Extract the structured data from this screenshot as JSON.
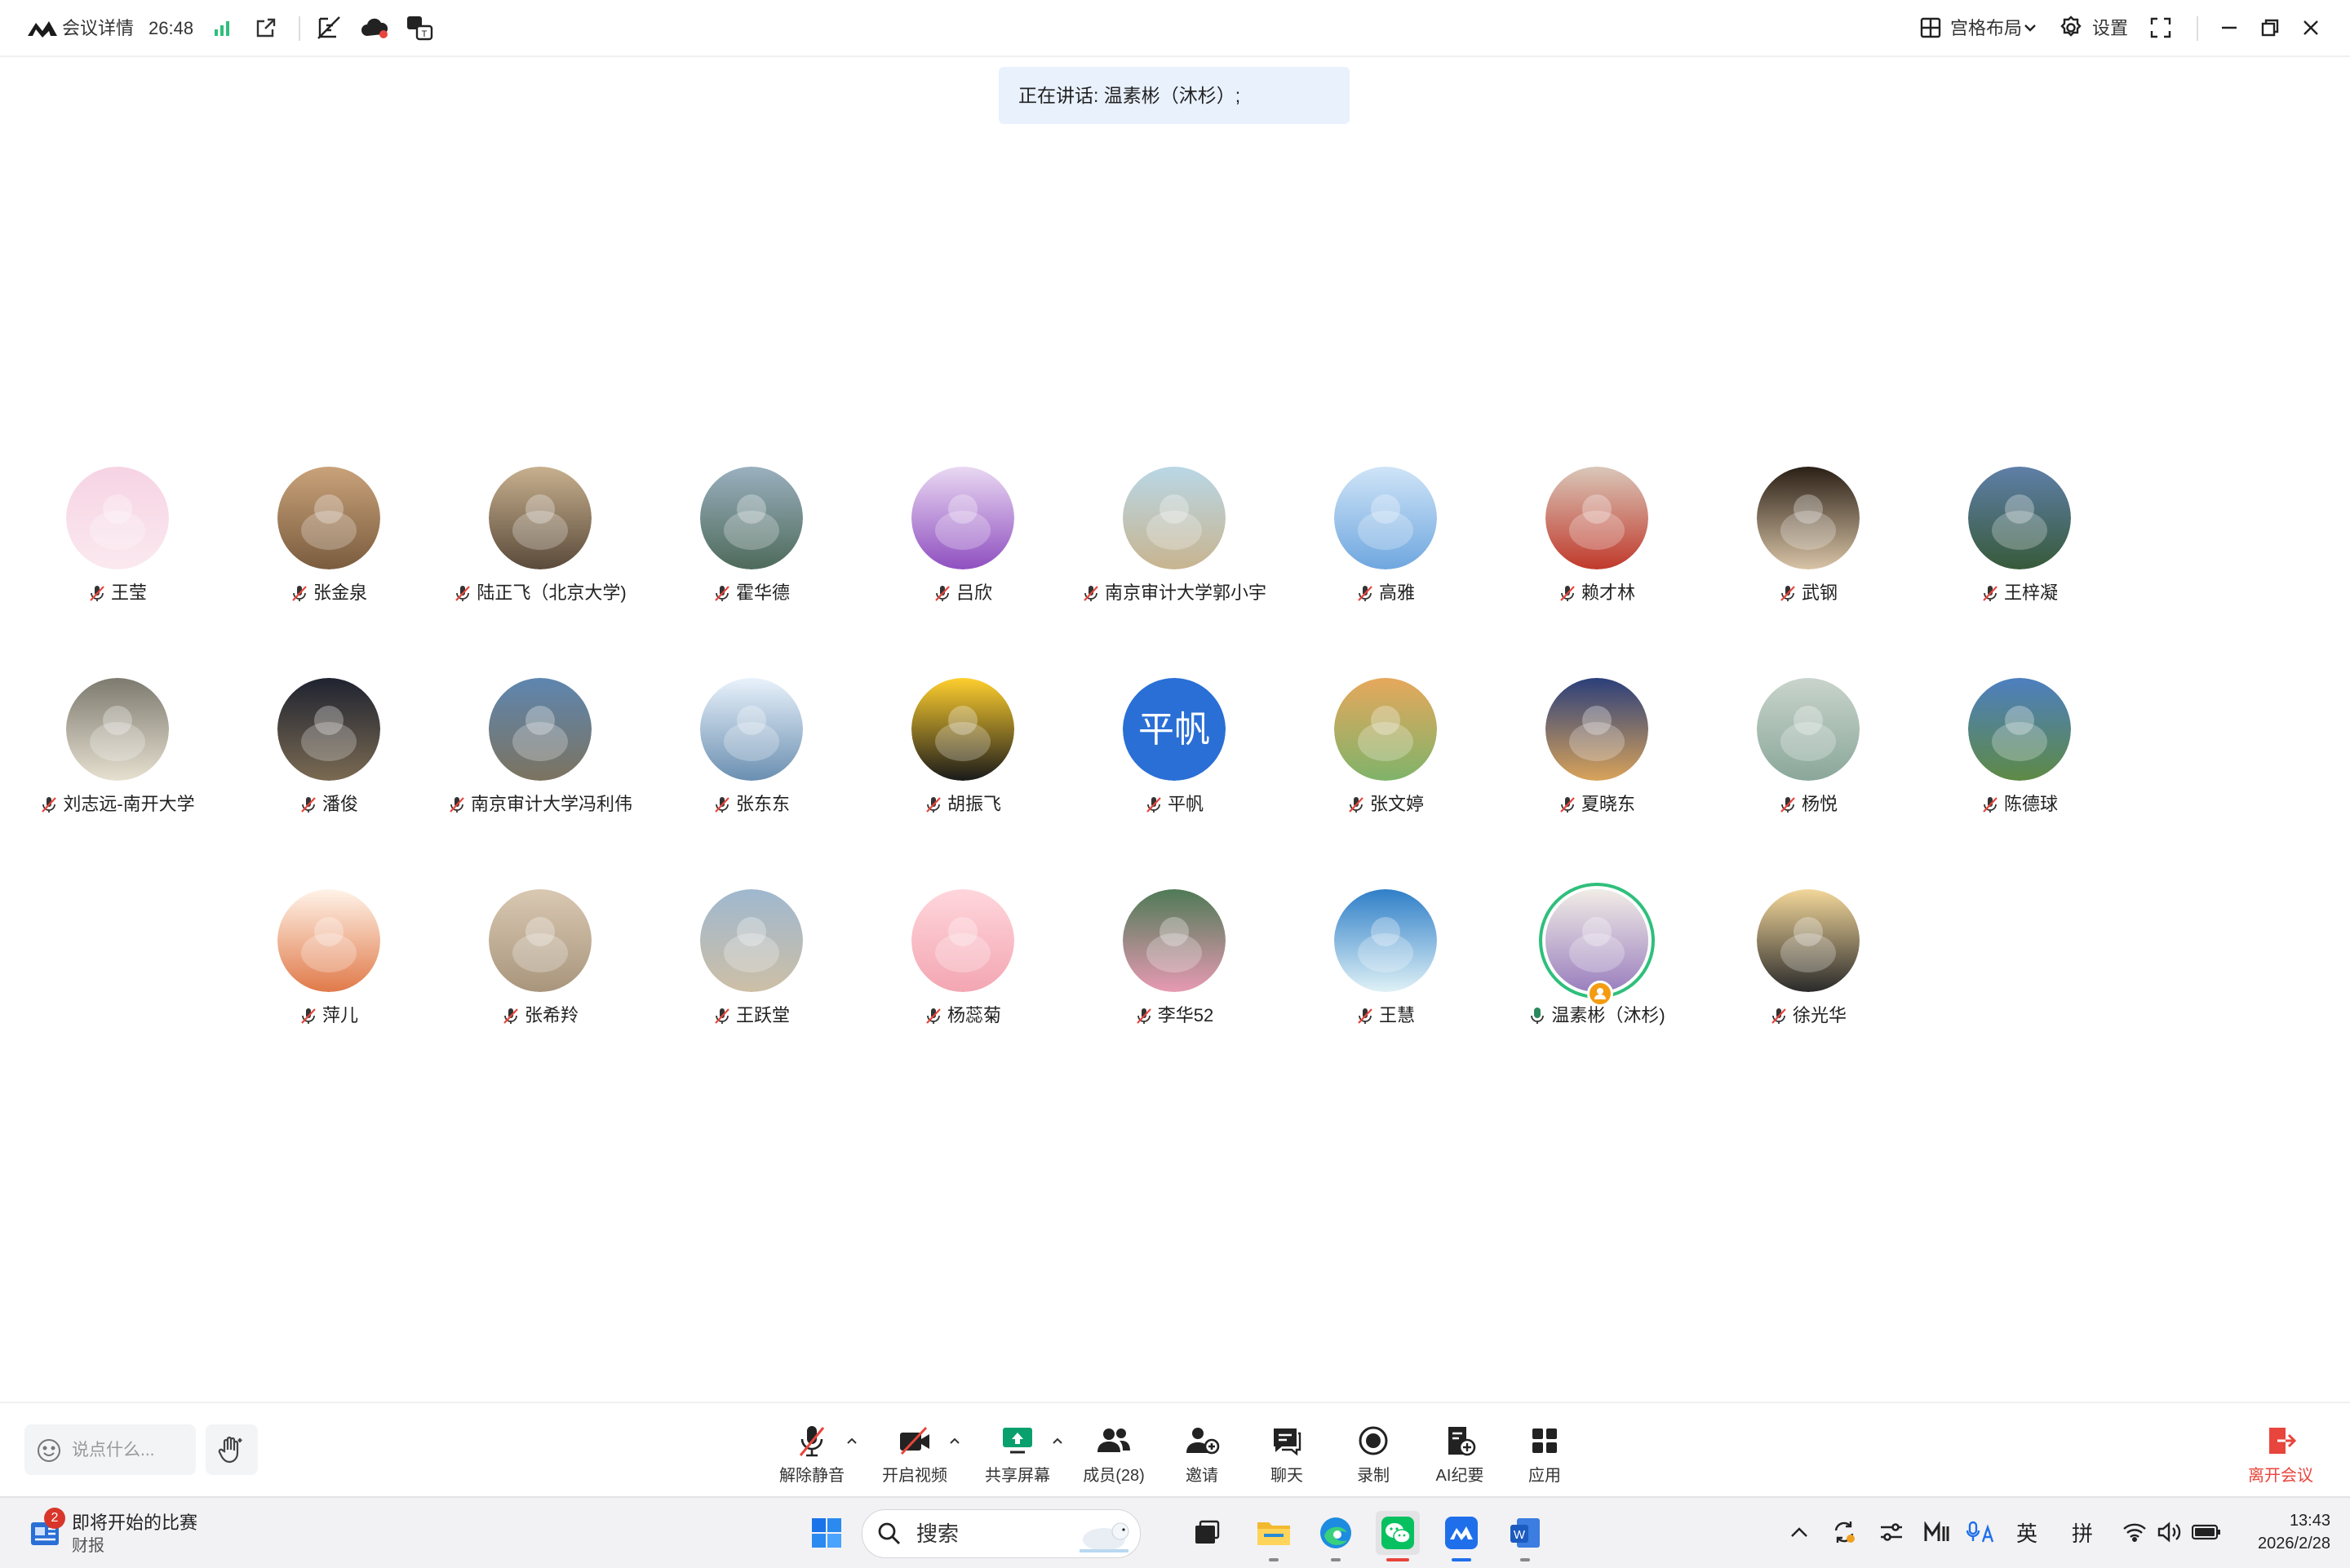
{
  "topbar": {
    "meeting_details": "会议详情",
    "duration": "26:48",
    "layout_label": "宫格布局",
    "settings_label": "设置"
  },
  "speaking": "正在讲话: 温素彬（沐杉）;",
  "participants": [
    {
      "name": "王莹",
      "muted": true
    },
    {
      "name": "张金泉",
      "muted": true
    },
    {
      "name": "陆正飞（北京大学)",
      "muted": true
    },
    {
      "name": "霍华德",
      "muted": true
    },
    {
      "name": "吕欣",
      "muted": true
    },
    {
      "name": "南京审计大学郭小宇",
      "muted": true
    },
    {
      "name": "高雅",
      "muted": true
    },
    {
      "name": "赖才林",
      "muted": true
    },
    {
      "name": "武钢",
      "muted": true
    },
    {
      "name": "王梓凝",
      "muted": true
    },
    {
      "name": "刘志远-南开大学",
      "muted": true
    },
    {
      "name": "潘俊",
      "muted": true
    },
    {
      "name": "南京审计大学冯利伟",
      "muted": true
    },
    {
      "name": "张东东",
      "muted": true
    },
    {
      "name": "胡振飞",
      "muted": true
    },
    {
      "name": "平帆",
      "muted": true,
      "avatar_text": "平帆"
    },
    {
      "name": "张文婷",
      "muted": true
    },
    {
      "name": "夏晓东",
      "muted": true
    },
    {
      "name": "杨悦",
      "muted": true
    },
    {
      "name": "陈德球",
      "muted": true
    },
    {
      "name": "萍儿",
      "muted": true
    },
    {
      "name": "张希羚",
      "muted": true
    },
    {
      "name": "王跃堂",
      "muted": true
    },
    {
      "name": "杨蕊菊",
      "muted": true
    },
    {
      "name": "李华52",
      "muted": true
    },
    {
      "name": "王慧",
      "muted": true
    },
    {
      "name": "温素彬（沐杉)",
      "muted": false,
      "speaking": true,
      "host": true
    },
    {
      "name": "徐光华",
      "muted": true
    }
  ],
  "toolbar": {
    "chat_placeholder": "说点什么...",
    "unmute": "解除静音",
    "start_video": "开启视频",
    "share_screen": "共享屏幕",
    "members": "成员(28)",
    "invite": "邀请",
    "chat": "聊天",
    "record": "录制",
    "ai_minutes": "AI纪要",
    "apps": "应用",
    "leave": "离开会议"
  },
  "taskbar": {
    "news_title": "即将开始的比赛",
    "news_source": "财报",
    "news_badge": "2",
    "search_label": "搜索",
    "ime_lang": "英",
    "ime_mode": "拼",
    "time": "13:43",
    "date": "2026/2/28"
  },
  "colors": {
    "accent_blue": "#1f6feb",
    "speaking_bg": "#e9f1fd",
    "leave_red": "#e8453c",
    "speaking_ring": "#2fbf7c",
    "wechat_green": "#07c160"
  }
}
